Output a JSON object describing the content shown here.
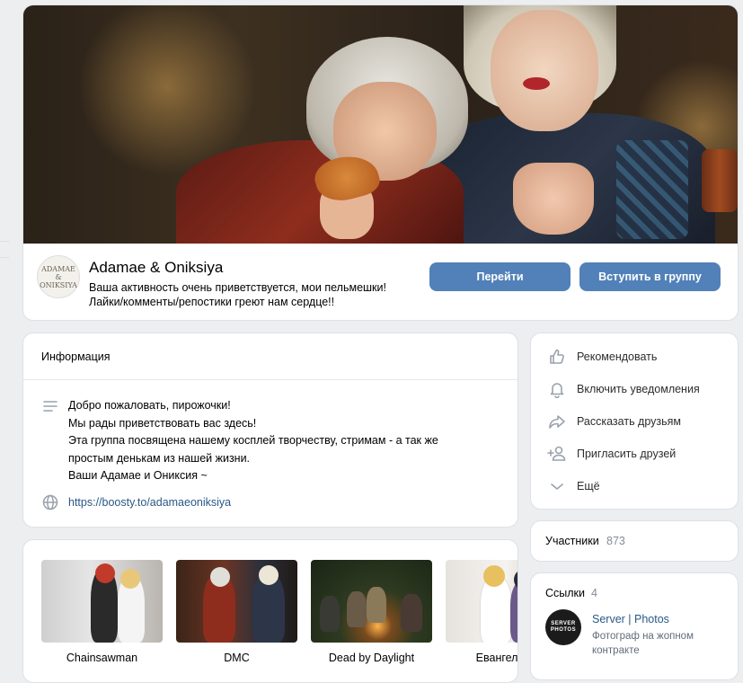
{
  "group": {
    "name": "Adamae & Oniksiya",
    "status_line1": "Ваша активность очень приветствуется, мои пельмешки!",
    "status_line2": "Лайки/комменты/репостики греют нам сердце!!",
    "avatar_line1": "ADAMAE",
    "avatar_line2": "&",
    "avatar_line3": "ONIKSIYA"
  },
  "buttons": {
    "go": "Перейти",
    "join": "Вступить в группу"
  },
  "info": {
    "title": "Информация",
    "description": [
      "Добро пожаловать, пирожочки!",
      "Мы рады приветствовать вас здесь!",
      "Эта группа посвящена нашему косплей творчеству, стримам - а так же",
      "простым денькам из нашей жизни.",
      "Ваши Адамае и Ониксия ~"
    ],
    "link": "https://boosty.to/adamaeoniksiya"
  },
  "albums": [
    {
      "title": "Chainsawman"
    },
    {
      "title": "DMC"
    },
    {
      "title": "Dead by Daylight"
    },
    {
      "title": "Евангелион"
    }
  ],
  "actions": [
    {
      "label": "Рекомендовать",
      "icon": "thumbs-up-icon"
    },
    {
      "label": "Включить уведомления",
      "icon": "bell-icon"
    },
    {
      "label": "Рассказать друзьям",
      "icon": "share-icon"
    },
    {
      "label": "Пригласить друзей",
      "icon": "add-user-icon"
    },
    {
      "label": "Ещё",
      "icon": "chevron-down-icon"
    }
  ],
  "members": {
    "label": "Участники",
    "count": "873"
  },
  "links": {
    "label": "Ссылки",
    "count": "4",
    "item": {
      "title": "Server | Photos",
      "description": "Фотограф на жопном контракте",
      "avatar_line1": "SERVER",
      "avatar_line2": "PHOTOS"
    }
  },
  "colors": {
    "accent": "#5181b8",
    "link": "#2a5885",
    "background": "#edeef0"
  }
}
